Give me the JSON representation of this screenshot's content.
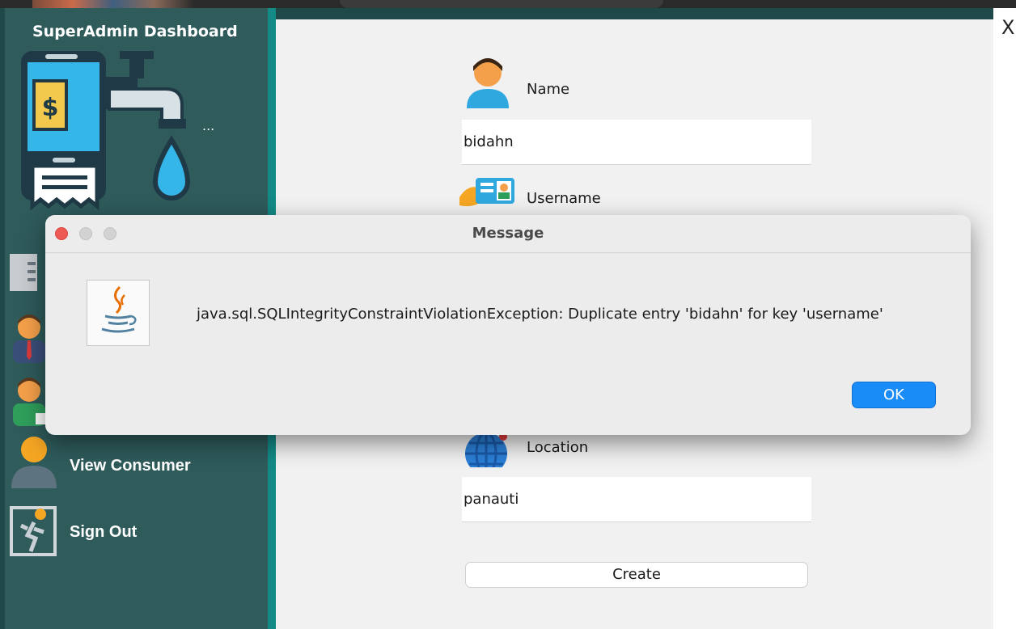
{
  "app": {
    "sidebar_title": "SuperAdmin Dashboard",
    "close_label": "X",
    "logo_ellipsis": "..."
  },
  "sidebar": {
    "items": [
      {
        "label": "",
        "icon": "list-icon"
      },
      {
        "label": "",
        "icon": "admin-user-icon"
      },
      {
        "label": "",
        "icon": "add-user-icon"
      },
      {
        "label": "View Consumer",
        "icon": "person-icon"
      },
      {
        "label": "Sign Out",
        "icon": "exit-door-icon"
      }
    ]
  },
  "form": {
    "name_label": "Name",
    "name_value": "bidahn",
    "username_label": "Username",
    "location_label": "Location",
    "location_value": "panauti",
    "create_label": "Create"
  },
  "dialog": {
    "title": "Message",
    "message": "java.sql.SQLIntegrityConstraintViolationException: Duplicate entry 'bidahn' for key 'username'",
    "ok_label": "OK"
  },
  "colors": {
    "sidebar_bg": "#2f5b5b",
    "teal_accent": "#138a86",
    "form_bg": "#f1f1f1",
    "ok_button": "#1a8cf7"
  }
}
